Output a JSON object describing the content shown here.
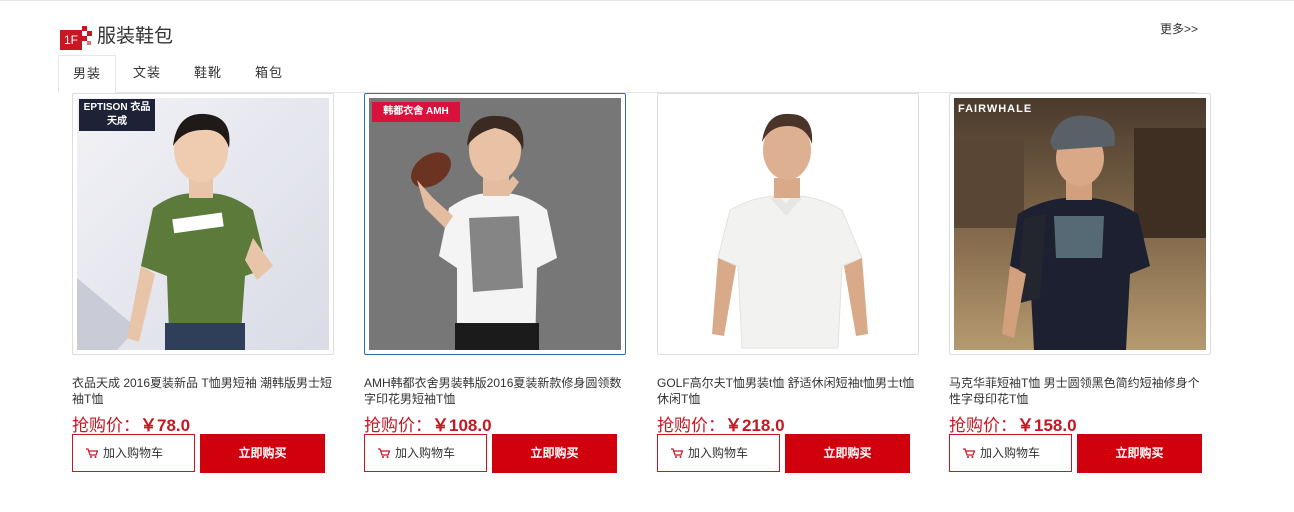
{
  "floor": {
    "badge": "1F",
    "title": "服装鞋包",
    "more": "更多>>"
  },
  "tabs": [
    "男装",
    "文装",
    "鞋靴",
    "箱包"
  ],
  "products": [
    {
      "brand_logo": "EPTISON 衣品天成",
      "name": "衣品天成 2016夏装新品 T恤男短袖 潮韩版男士短袖T恤",
      "price_label": "抢购价：",
      "price": "￥78.0",
      "cart_label": "加入购物车",
      "buy_label": "立即购买"
    },
    {
      "brand_logo": "韩都衣舍 AMH",
      "name": "AMH韩都衣舍男装韩版2016夏装新款修身圆领数字印花男短袖T恤",
      "price_label": "抢购价：",
      "price": "￥108.0",
      "cart_label": "加入购物车",
      "buy_label": "立即购买"
    },
    {
      "brand_logo": "",
      "name": "GOLF高尔夫T恤男装t恤 舒适休闲短袖t恤男士t恤休闲T恤",
      "price_label": "抢购价：",
      "price": "￥218.0",
      "cart_label": "加入购物车",
      "buy_label": "立即购买"
    },
    {
      "brand_logo": "FAIRWHALE",
      "name": "马克华菲短袖T恤 男士圆领黑色简约短袖修身个性字母印花T恤",
      "price_label": "抢购价：",
      "price": "￥158.0",
      "cart_label": "加入购物车",
      "buy_label": "立即购买"
    }
  ],
  "colors": {
    "accent": "#c81623",
    "buy_button": "#d0000d",
    "hover_border": "#2f6fb3"
  }
}
